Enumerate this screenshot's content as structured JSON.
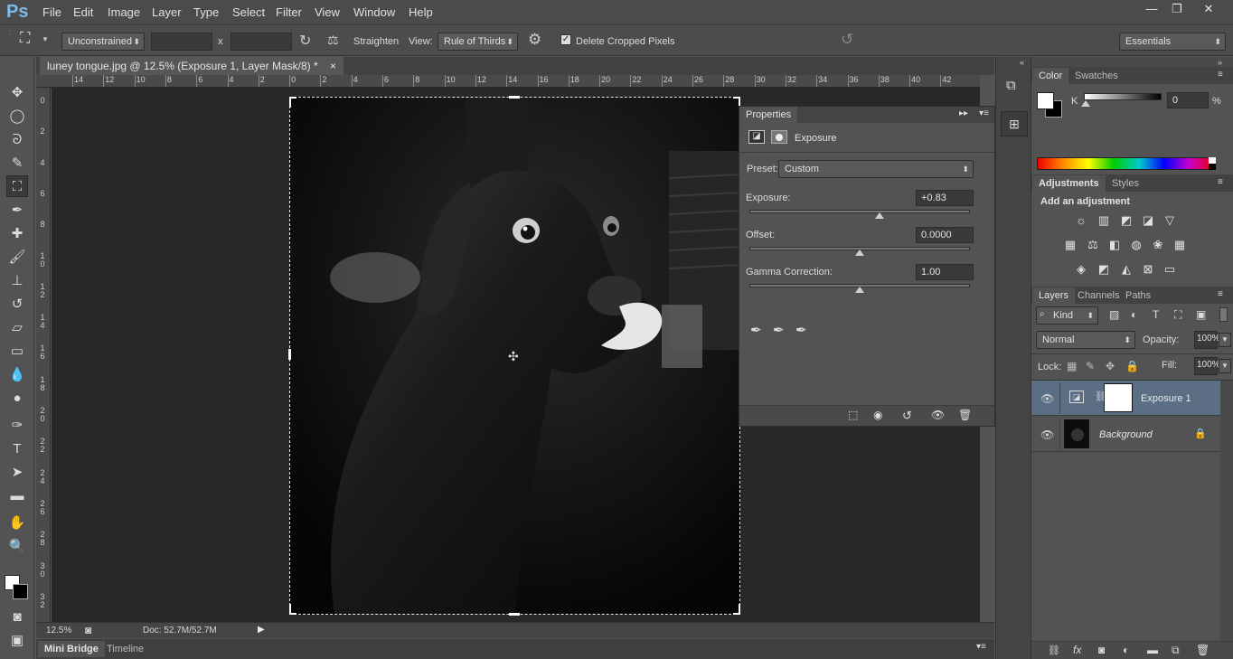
{
  "app": {
    "logo": "Ps"
  },
  "menu": [
    "File",
    "Edit",
    "Image",
    "Layer",
    "Type",
    "Select",
    "Filter",
    "View",
    "Window",
    "Help"
  ],
  "window_controls": {
    "minimize": "—",
    "restore": "❐",
    "close": "✕"
  },
  "options": {
    "ratio": "Unconstrained",
    "width_value": "",
    "height_value": "",
    "x_sep": "x",
    "straighten": "Straighten",
    "view_label": "View:",
    "view_value": "Rule of Thirds",
    "delete_cropped": "Delete Cropped Pixels",
    "workspace": "Essentials"
  },
  "document": {
    "tab_title": "luney tongue.jpg @ 12.5% (Exposure 1, Layer Mask/8) *",
    "close": "×",
    "ruler_h": [
      "14",
      "12",
      "10",
      "8",
      "6",
      "4",
      "2",
      "0",
      "2",
      "4",
      "6",
      "8",
      "10",
      "12",
      "14",
      "16",
      "18",
      "20",
      "22",
      "24",
      "26",
      "28",
      "30",
      "32",
      "34",
      "36",
      "38",
      "40",
      "42"
    ],
    "ruler_v": [
      "0",
      "2",
      "4",
      "6",
      "8",
      "10",
      "12",
      "14",
      "16",
      "18",
      "20",
      "22",
      "24",
      "26",
      "28",
      "30",
      "32"
    ]
  },
  "status": {
    "zoom": "12.5%",
    "doc": "Doc: 52.7M/52.7M"
  },
  "bottom_tabs": [
    "Mini Bridge",
    "Timeline"
  ],
  "properties": {
    "title": "Properties",
    "kind": "Exposure",
    "preset_label": "Preset:",
    "preset_value": "Custom",
    "exposure_label": "Exposure:",
    "exposure_value": "+0.83",
    "exposure_pos": 0.59,
    "offset_label": "Offset:",
    "offset_value": "0.0000",
    "offset_pos": 0.5,
    "gamma_label": "Gamma Correction:",
    "gamma_value": "1.00",
    "gamma_pos": 0.5
  },
  "color_panel": {
    "tabs": [
      "Color",
      "Swatches"
    ],
    "k_label": "K",
    "k_value": "0",
    "k_unit": "%"
  },
  "adjustments_panel": {
    "tabs": [
      "Adjustments",
      "Styles"
    ],
    "heading": "Add an adjustment"
  },
  "layers_panel": {
    "tabs": [
      "Layers",
      "Channels",
      "Paths"
    ],
    "kind_filter": "Kind",
    "blend_mode": "Normal",
    "opacity_label": "Opacity:",
    "opacity_value": "100%",
    "lock_label": "Lock:",
    "fill_label": "Fill:",
    "fill_value": "100%",
    "layers": [
      {
        "name": "Exposure 1"
      },
      {
        "name": "Background"
      }
    ],
    "footer_icons": [
      "link-icon",
      "fx-icon",
      "mask-icon",
      "adjustment-icon",
      "folder-icon",
      "new-layer-icon",
      "trash-icon"
    ]
  },
  "colors": {
    "accent": "#7fb9e6",
    "selected_layer": "#5b6e84"
  }
}
